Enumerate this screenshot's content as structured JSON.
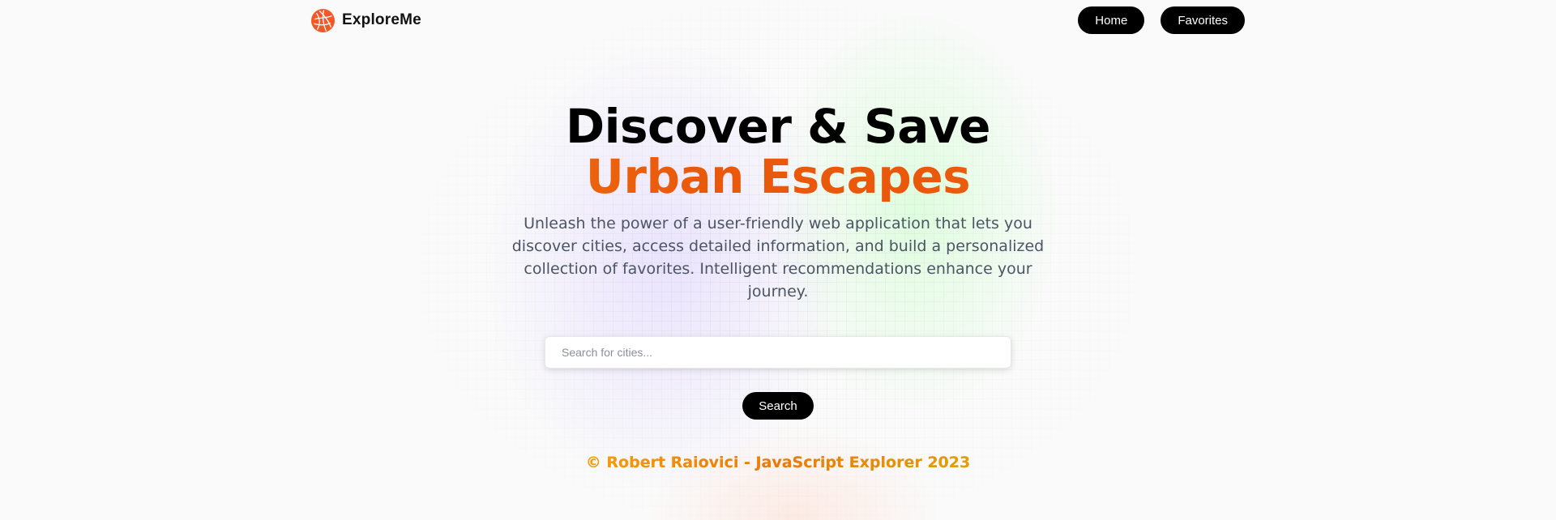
{
  "colors": {
    "accent_start": "#f59e0b",
    "accent_mid": "#ea580c",
    "accent_end": "#eab308",
    "button_bg": "#000000",
    "button_text": "#ffffff",
    "subtitle_text": "#4b5563"
  },
  "header": {
    "logo_icon": "globe-icon",
    "brand": "ExploreMe",
    "nav": [
      {
        "label": "Home"
      },
      {
        "label": "Favorites"
      }
    ]
  },
  "hero": {
    "title_line1": "Discover & Save",
    "title_line2": "Urban Escapes",
    "subtitle": "Unleash the power of a user-friendly web application that lets you discover cities, access detailed information, and build a personalized collection of favorites. Intelligent recommendations enhance your journey."
  },
  "search": {
    "placeholder": "Search for cities...",
    "value": "",
    "button_label": "Search"
  },
  "footer": {
    "text": "© Robert Raiovici - JavaScript Explorer 2023"
  }
}
